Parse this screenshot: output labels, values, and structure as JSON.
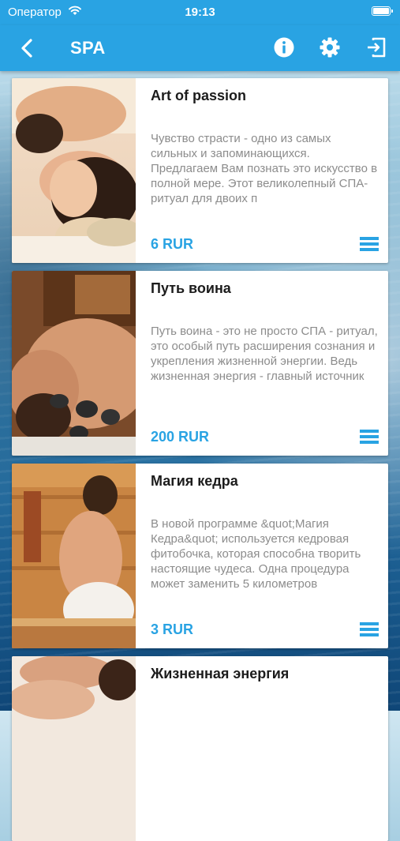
{
  "status": {
    "carrier": "Оператор",
    "time": "19:13"
  },
  "nav": {
    "title": "SPA"
  },
  "items": [
    {
      "title": "Art of passion",
      "description": "Чувство страсти - одно из самых сильных и запоминающихся. Предлагаем Вам познать это искусство в полной мере. Этот великолепный СПА-ритуал для двоих п",
      "price": "6 RUR",
      "image": "couple-massage-photo"
    },
    {
      "title": "Путь воина",
      "description": "Путь воина - это не просто СПА - ритуал, это особый путь расширения сознания и укрепления жизненной энергии. Ведь жизненная энергия - главный источник",
      "price": "200 RUR",
      "image": "hot-stone-massage-photo"
    },
    {
      "title": "Магия кедра",
      "description": "В новой программе &quot;Магия Кедра&quot; используется кедровая фитобочка, которая способна творить настоящие чудеса. Одна процедура может заменить 5 километров",
      "price": "3 RUR",
      "image": "sauna-photo"
    },
    {
      "title": "Жизненная энергия",
      "description": "",
      "price": "",
      "image": "back-massage-photo"
    }
  ],
  "colors": {
    "accent": "#29a3e3",
    "title_text": "#1c1c1c",
    "desc_text": "#8c8c8c"
  },
  "icons": [
    "wifi-icon",
    "battery-icon",
    "chevron-left-icon",
    "info-icon",
    "gear-icon",
    "exit-icon",
    "menu-icon"
  ]
}
